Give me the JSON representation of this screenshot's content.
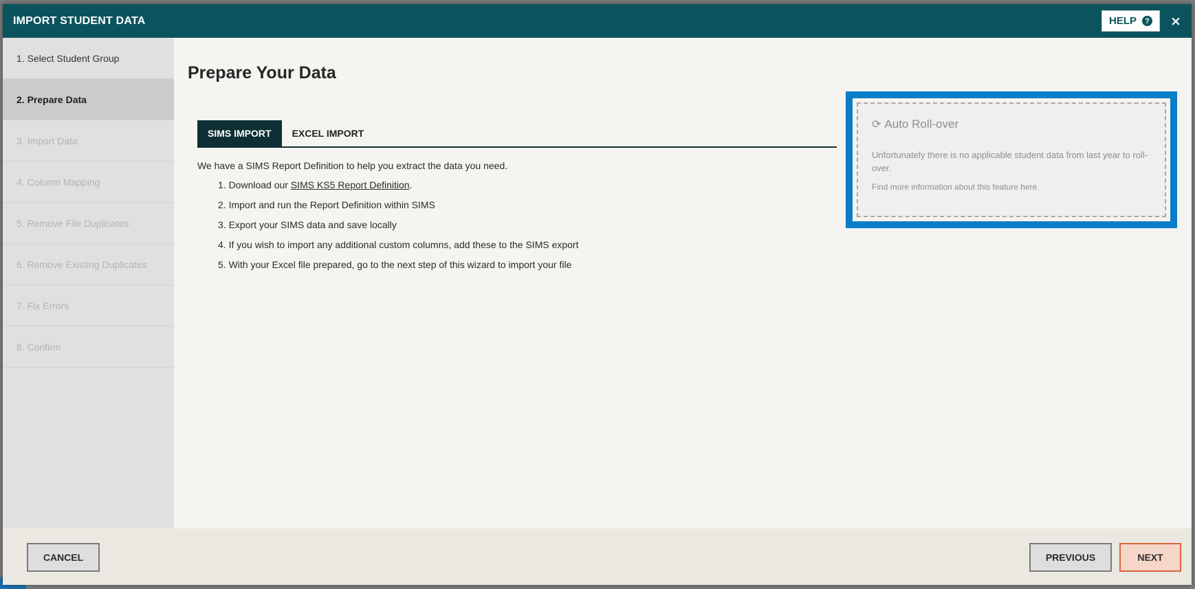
{
  "modal": {
    "title": "IMPORT STUDENT DATA",
    "help_label": "HELP",
    "help_icon": "question-circle-icon",
    "close_label": "×"
  },
  "steps": [
    {
      "label": "1. Select Student Group",
      "state": "done"
    },
    {
      "label": "2. Prepare Data",
      "state": "active"
    },
    {
      "label": "3. Import Data",
      "state": "disabled"
    },
    {
      "label": "4. Column Mapping",
      "state": "disabled"
    },
    {
      "label": "5. Remove File Duplicates",
      "state": "disabled"
    },
    {
      "label": "6. Remove Existing Duplicates",
      "state": "disabled"
    },
    {
      "label": "7. Fix Errors",
      "state": "disabled"
    },
    {
      "label": "8. Confirm",
      "state": "disabled"
    }
  ],
  "content": {
    "page_title": "Prepare Your Data",
    "tabs": [
      {
        "label": "SIMS IMPORT",
        "active": true
      },
      {
        "label": "EXCEL IMPORT",
        "active": false
      }
    ],
    "intro": "We have a SIMS Report Definition to help you extract the data you need.",
    "step1_prefix": "1. Download our ",
    "step1_link": "SIMS KS5 Report Definition",
    "step1_suffix": ".",
    "step2": "2. Import and run the Report Definition within SIMS",
    "step3": "3. Export your SIMS data and save locally",
    "step4": "4. If you wish to import any additional custom columns, add these to the SIMS export",
    "step5": "5. With your Excel file prepared, go to the next step of this wizard to import your file"
  },
  "rollover": {
    "icon": "refresh-icon",
    "title": "Auto Roll-over",
    "message": "Unfortunately there is no applicable student data from last year to roll-over.",
    "info": "Find more information about this feature here.",
    "highlight_color": "#0a7dc9"
  },
  "footer": {
    "cancel_label": "CANCEL",
    "previous_label": "PREVIOUS",
    "next_label": "NEXT"
  },
  "colors": {
    "header": "#0b545d",
    "active_tab": "#0e2f33",
    "next_border": "#d9653a"
  }
}
